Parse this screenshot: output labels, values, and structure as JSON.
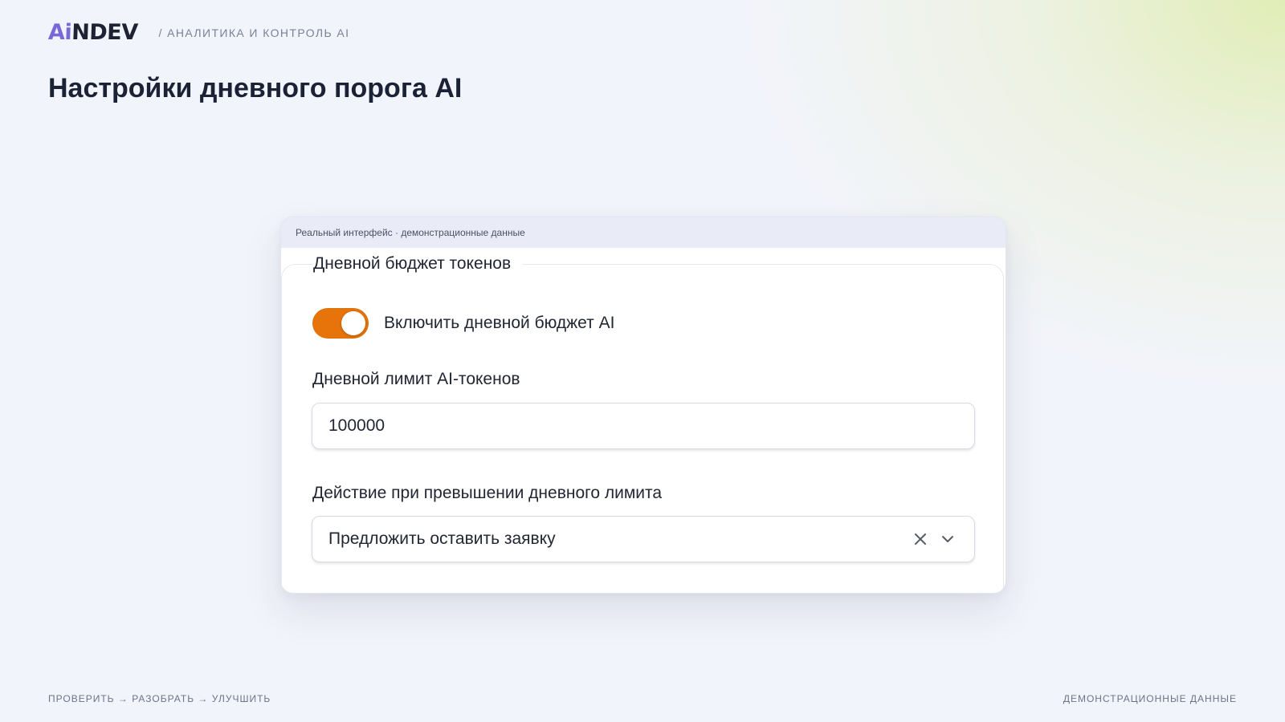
{
  "header": {
    "logo": {
      "accent": "Ai",
      "rest": "NDEV"
    },
    "breadcrumb": "/ АНАЛИТИКА И КОНТРОЛЬ AI"
  },
  "page": {
    "title": "Настройки дневного порога AI"
  },
  "card": {
    "caption": "Реальный интерфейс · демонстрационные данные",
    "section_title": "Дневной бюджет токенов",
    "toggle": {
      "label": "Включить дневной бюджет AI",
      "checked": true
    },
    "limit": {
      "label": "Дневной лимит AI-токенов",
      "value": "100000"
    },
    "action": {
      "label": "Действие при превышении дневного лимита",
      "selected": "Предложить оставить заявку"
    }
  },
  "footer": {
    "left": "ПРОВЕРИТЬ → РАЗОБРАТЬ → УЛУЧШИТЬ",
    "right": "ДЕМОНСТРАЦИОННЫЕ ДАННЫЕ"
  },
  "colors": {
    "accent_orange": "#e6740a",
    "logo_purple": "#7868d8",
    "text_dark": "#1c2236"
  },
  "icons": {
    "clear": "close-icon",
    "dropdown": "chevron-down-icon"
  }
}
